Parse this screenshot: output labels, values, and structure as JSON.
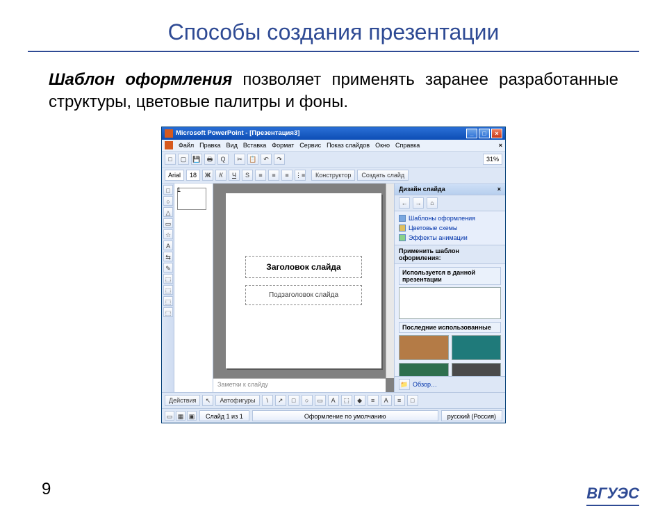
{
  "slide": {
    "title": "Способы создания презентации",
    "body_em": "Шаблон оформления",
    "body_rest": " позволяет применять заранее разработанные структуры, цветовые палитры и фоны.",
    "page_number": "9",
    "logo_text": "ВГУЭС"
  },
  "pp": {
    "title": "Microsoft PowerPoint - [Презентация3]",
    "sys": {
      "min": "_",
      "max": "□",
      "close": "×"
    },
    "menu": [
      "Файл",
      "Правка",
      "Вид",
      "Вставка",
      "Формат",
      "Сервис",
      "Показ слайдов",
      "Окно",
      "Справка"
    ],
    "mdi_close": "×",
    "std_toolbar": {
      "zoom": "31%",
      "buttons": [
        "□",
        "▢",
        "💾",
        "🖶",
        "Q",
        "✂",
        "📋",
        "↶",
        "↷"
      ]
    },
    "fmt_toolbar": {
      "font": "Arial",
      "size": "18",
      "b": "Ж",
      "i": "К",
      "u": "Ч",
      "s": "S",
      "constructor": "Конструктор",
      "new_slide": "Создать слайд"
    },
    "left_rail_icons": [
      "□",
      "○",
      "△",
      "▭",
      "☆",
      "A",
      "⇆",
      "✎",
      "⬚",
      "⬚",
      "⬚",
      "⬚"
    ],
    "outline": {
      "num": "1"
    },
    "canvas": {
      "title_ph": "Заголовок слайда",
      "sub_ph": "Подзаголовок слайда",
      "notes_ph": "Заметки к слайду"
    },
    "task_pane": {
      "header": "Дизайн слайда",
      "header_close": "×",
      "nav_back": "←",
      "nav_fwd": "→",
      "nav_home": "⌂",
      "links": [
        "Шаблоны оформления",
        "Цветовые схемы",
        "Эффекты анимации"
      ],
      "apply_label": "Применить шаблон оформления:",
      "used_label": "Используется в данной презентации",
      "recent_label": "Последние использованные",
      "browse": "Обзор…"
    },
    "draw": {
      "actions": "Действия",
      "autoshapes": "Автофигуры",
      "shape_icons": [
        "\\",
        "↗",
        "□",
        "○",
        "▭",
        "A",
        "⬚",
        "◆",
        "≡",
        "A",
        "≡",
        "□"
      ]
    },
    "status": {
      "slide": "Слайд 1 из 1",
      "design": "Оформление по умолчанию",
      "lang": "русский (Россия)"
    }
  }
}
